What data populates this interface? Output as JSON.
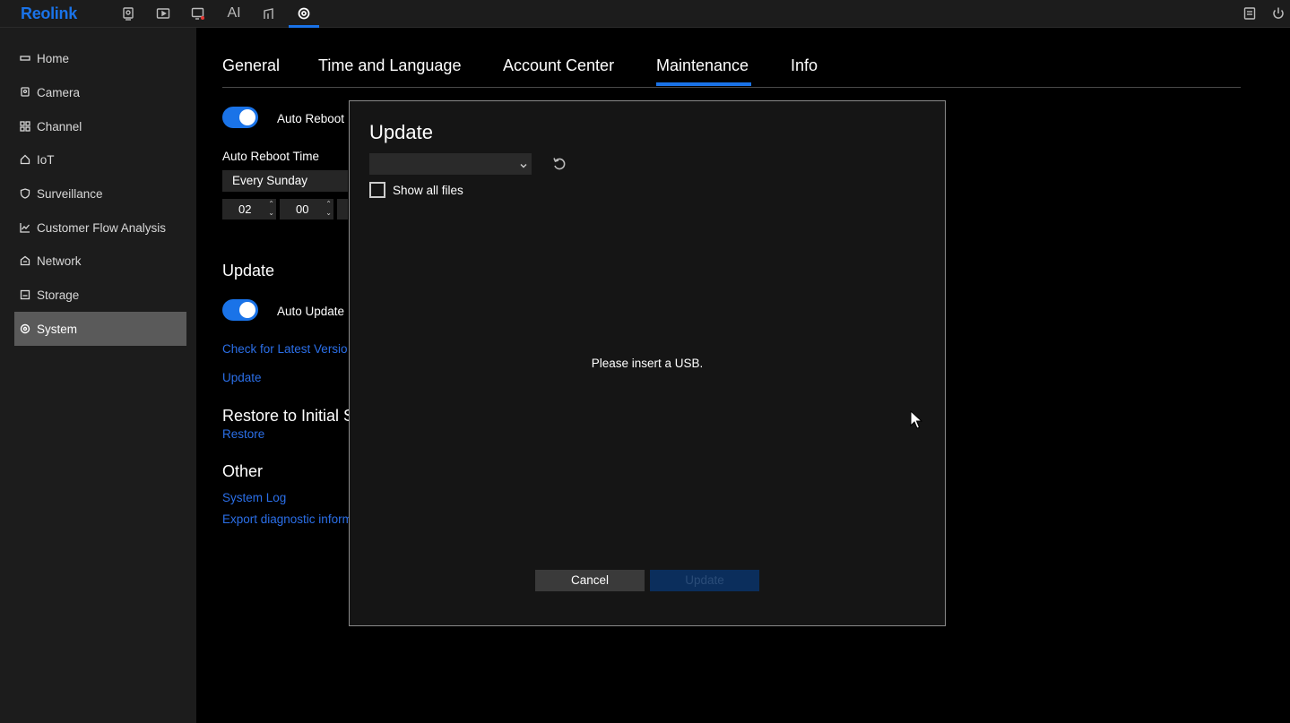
{
  "app": {
    "logo": "Reolink"
  },
  "topbar": {
    "ai_label": "AI",
    "icons": [
      "camera-icon",
      "playback-icon",
      "alarm-icon",
      "ai-icon",
      "device-icon",
      "settings-icon",
      "notes-icon",
      "power-icon"
    ]
  },
  "sidebar": {
    "items": [
      {
        "label": "Home",
        "icon": "home-icon"
      },
      {
        "label": "Camera",
        "icon": "camera-icon"
      },
      {
        "label": "Channel",
        "icon": "channel-icon"
      },
      {
        "label": "IoT",
        "icon": "iot-icon"
      },
      {
        "label": "Surveillance",
        "icon": "shield-icon"
      },
      {
        "label": "Customer Flow Analysis",
        "icon": "chart-icon"
      },
      {
        "label": "Network",
        "icon": "network-icon"
      },
      {
        "label": "Storage",
        "icon": "storage-icon"
      },
      {
        "label": "System",
        "icon": "gear-icon"
      }
    ],
    "active": "System"
  },
  "tabs": [
    {
      "label": "General"
    },
    {
      "label": "Time and Language"
    },
    {
      "label": "Account Center"
    },
    {
      "label": "Maintenance"
    },
    {
      "label": "Info"
    }
  ],
  "active_tab": "Maintenance",
  "maintenance": {
    "auto_reboot_label": "Auto Reboot",
    "auto_reboot_enabled": true,
    "auto_reboot_time_label": "Auto Reboot Time",
    "reboot_day": "Every Sunday",
    "reboot_hour": "02",
    "reboot_minute": "00",
    "update_section": "Update",
    "auto_update_label": "Auto Update",
    "auto_update_enabled": true,
    "check_latest_link": "Check for Latest Versio",
    "update_link": "Update",
    "restore_section": "Restore to Initial S",
    "restore_link": "Restore",
    "other_section": "Other",
    "system_log_link": "System Log",
    "export_diag_link": "Export diagnostic inform"
  },
  "modal": {
    "title": "Update",
    "file_select_value": "",
    "show_all_files_label": "Show all files",
    "show_all_files_checked": false,
    "message": "Please insert a USB.",
    "cancel_label": "Cancel",
    "update_label": "Update"
  },
  "colors": {
    "accent": "#1a73e8",
    "link": "#2b6fe8",
    "sidebar_bg": "#1c1c1c",
    "active_item_bg": "#5a5a5a",
    "modal_bg": "#151515",
    "update_btn_disabled": "#0b2e5c"
  }
}
